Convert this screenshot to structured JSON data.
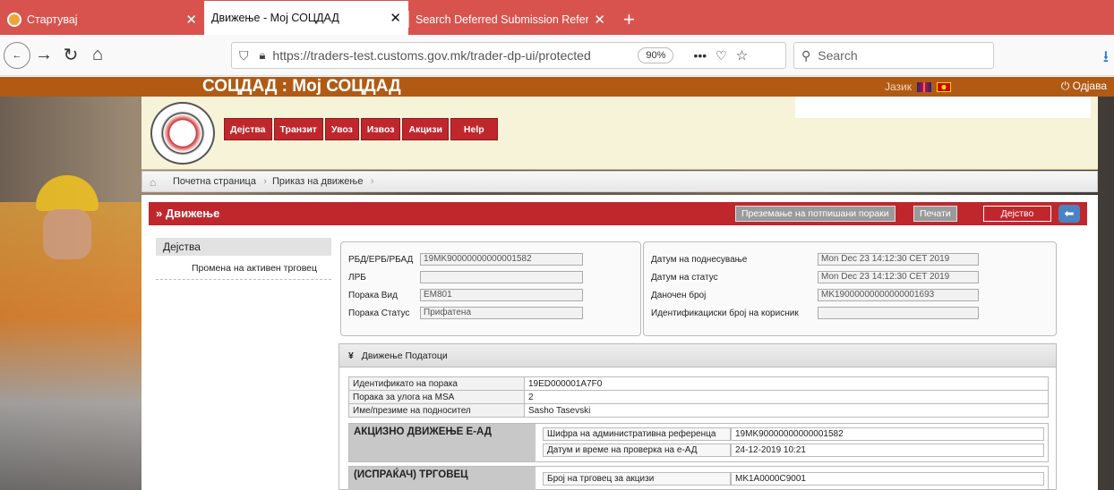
{
  "browser": {
    "tabs": [
      {
        "title": "Стартувај",
        "close": "✕",
        "active": false
      },
      {
        "title": "Движење - Мој СОЦДАД",
        "close": "✕",
        "active": true
      },
      {
        "title": "Search Deferred Submission Referer",
        "close": "✕",
        "active": false
      }
    ],
    "new_tab": "+",
    "url": "https://traders-test.customs.gov.mk/trader-dp-ui/protected",
    "zoom": "90%",
    "more": "•••",
    "search_placeholder": "Search"
  },
  "site": {
    "title": "СОЦДАД : Мој СОЦДАД",
    "language_label": "Јазик",
    "logout_label": "Одјава"
  },
  "menu": [
    "Дејства",
    "Транзит",
    "Увоз",
    "Извоз",
    "Акцизи",
    "Help"
  ],
  "breadcrumb": [
    "Почетна страница",
    "Приказ на движење"
  ],
  "panel": {
    "title": "» Движење",
    "btn_download": "Преземање на потпишани пораки",
    "btn_print": "Печати",
    "btn_action": "Дејство"
  },
  "sidebar": {
    "header": "Дејства",
    "items": [
      "Промена на активен трговец"
    ]
  },
  "info_left": [
    {
      "label": "РБД/ЕРБ/РБАД",
      "value": "19MK90000000000001582"
    },
    {
      "label": "ЛРБ",
      "value": ""
    },
    {
      "label": "Порака Вид",
      "value": "EM801"
    },
    {
      "label": "Порака Статус",
      "value": "Прифатена"
    }
  ],
  "info_right": [
    {
      "label": "Датум на поднесување",
      "value": "Mon Dec 23 14:12:30 CET 2019"
    },
    {
      "label": "Датум на статус",
      "value": "Mon Dec 23 14:12:30 CET 2019"
    },
    {
      "label": "Даночен број",
      "value": "MK19000000000000001693"
    },
    {
      "label": "Идентификациски број на корисник",
      "value": ""
    }
  ],
  "section": {
    "title": "Движење Податоци",
    "rows": [
      {
        "label": "Идентификато на порака",
        "value": "19ED000001A7F0"
      },
      {
        "label": "Порака за улога на MSA",
        "value": "2"
      },
      {
        "label": "Име/презиме на подносител",
        "value": "Sasho Tasevski"
      }
    ],
    "block1": {
      "title": "АКЦИЗНО ДВИЖЕЊЕ Е-АД",
      "rows": [
        {
          "label": "Шифра на административна референца",
          "value": "19MK90000000000001582"
        },
        {
          "label": "Датум и време на проверка на е-АД",
          "value": "24-12-2019 10:21"
        }
      ]
    },
    "block2": {
      "title": "(ИСПРАЌАЧ) ТРГОВЕЦ",
      "rows": [
        {
          "label": "Број на трговец за акцизи",
          "value": "MK1A0000C9001"
        }
      ]
    }
  }
}
